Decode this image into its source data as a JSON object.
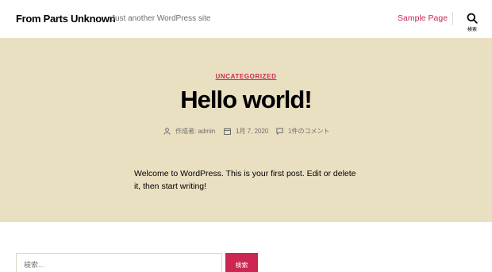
{
  "header": {
    "site_title": "From Parts Unknown",
    "site_description": "Just another WordPress site",
    "nav": [
      {
        "label": "Sample Page"
      }
    ],
    "search_toggle_label": "検索"
  },
  "post": {
    "category": "UNCATEGORIZED",
    "title": "Hello world!",
    "meta": {
      "author": "作成者: admin",
      "date": "1月 7, 2020",
      "comments": "1件のコメント"
    },
    "body": "Welcome to WordPress. This is your first post. Edit or delete it, then start writing!"
  },
  "search_form": {
    "placeholder": "検索...",
    "button_label": "検索"
  },
  "colors": {
    "accent": "#cd2653",
    "hero_background": "#e9dfc1",
    "muted_text": "#6d6d6d"
  }
}
